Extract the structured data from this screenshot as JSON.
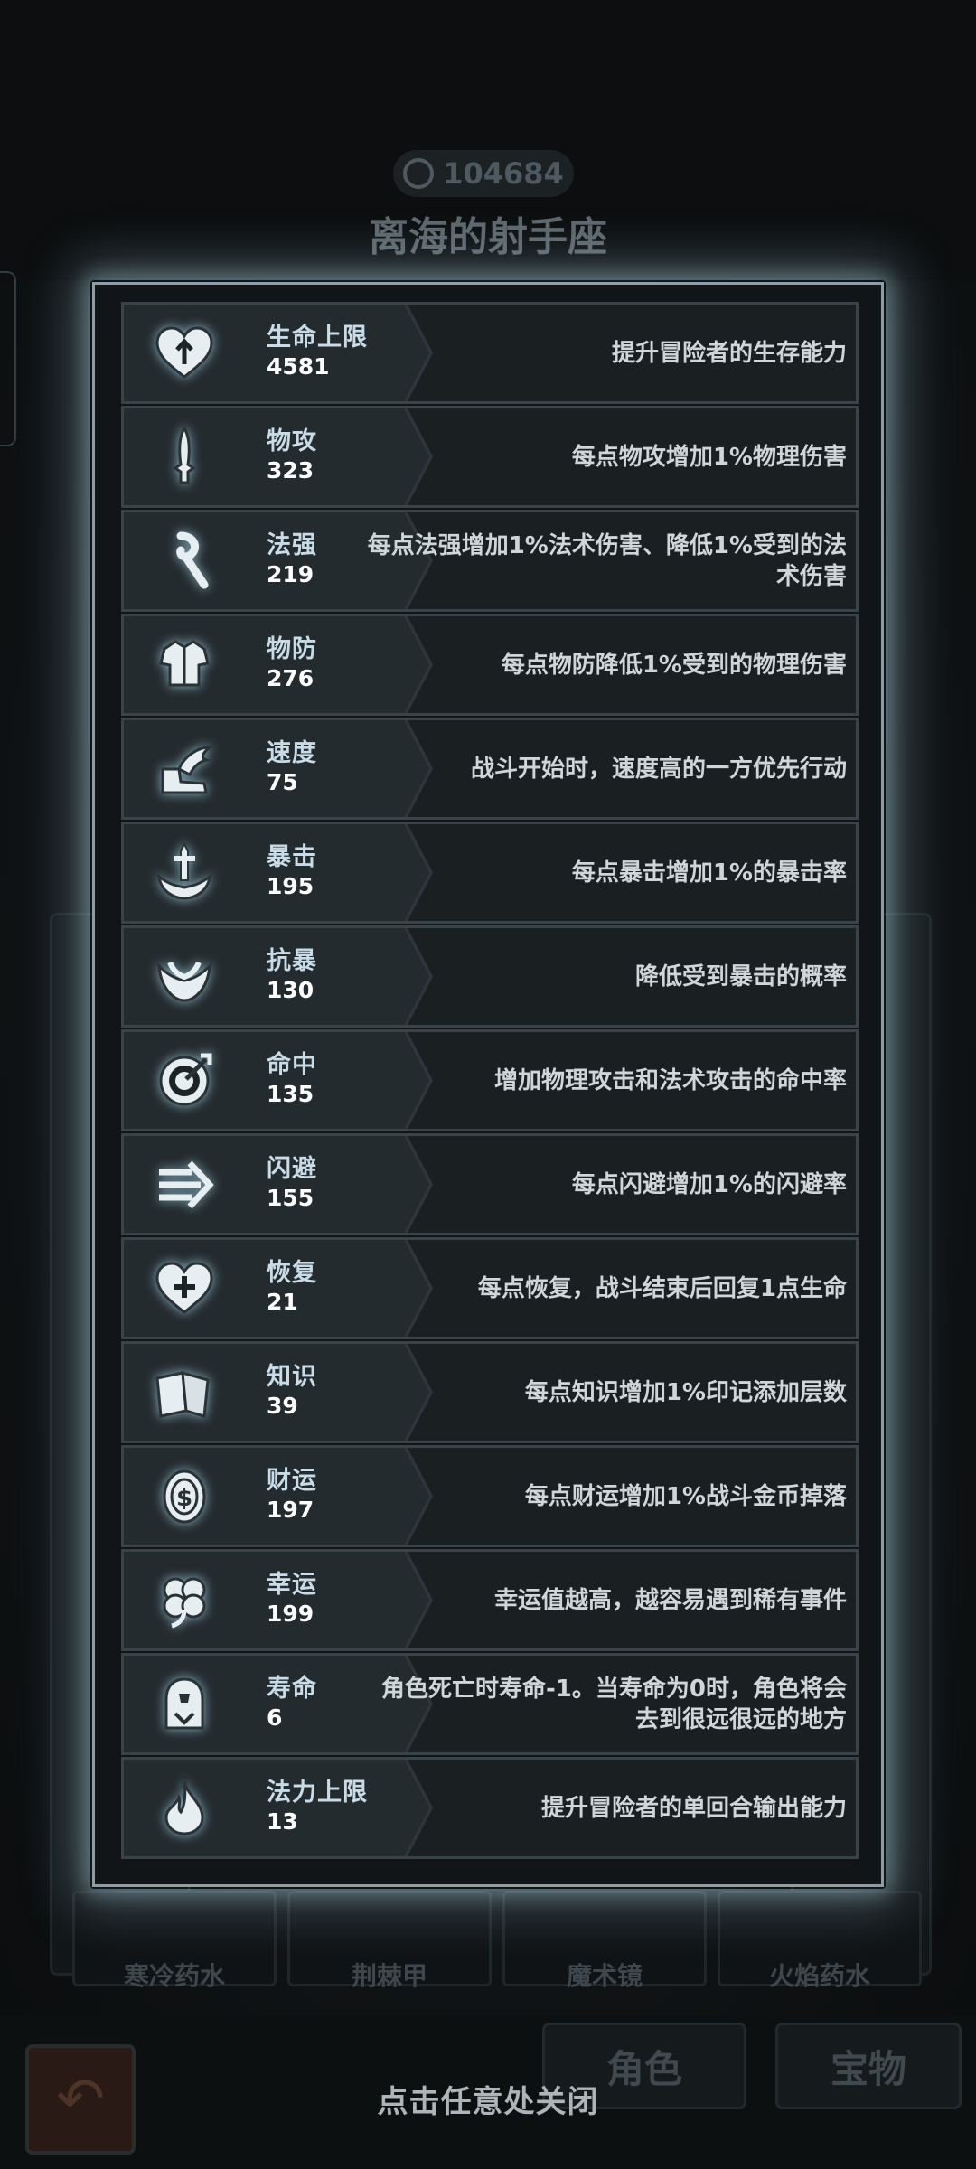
{
  "background": {
    "score": "104684",
    "title": "离海的射手座",
    "bottom_items": [
      "寒冷药水",
      "荆棘甲",
      "魔术镜",
      "火焰药水"
    ],
    "nav_tabs": [
      "角色",
      "宝物"
    ]
  },
  "stats": [
    {
      "icon": "heart-up-icon",
      "name": "生命上限",
      "value": "4581",
      "desc": "提升冒险者的生存能力"
    },
    {
      "icon": "sword-icon",
      "name": "物攻",
      "value": "323",
      "desc": "每点物攻增加1%物理伤害"
    },
    {
      "icon": "staff-icon",
      "name": "法强",
      "value": "219",
      "desc": "每点法强增加1%法术伤害、降低1%受到的法术伤害"
    },
    {
      "icon": "armor-icon",
      "name": "物防",
      "value": "276",
      "desc": "每点物防降低1%受到的物理伤害"
    },
    {
      "icon": "winged-boot-icon",
      "name": "速度",
      "value": "75",
      "desc": "战斗开始时，速度高的一方优先行动"
    },
    {
      "icon": "crit-sword-icon",
      "name": "暴击",
      "value": "195",
      "desc": "每点暴击增加1%的暴击率"
    },
    {
      "icon": "crit-resist-icon",
      "name": "抗暴",
      "value": "130",
      "desc": "降低受到暴击的概率"
    },
    {
      "icon": "target-icon",
      "name": "命中",
      "value": "135",
      "desc": "增加物理攻击和法术攻击的命中率"
    },
    {
      "icon": "dodge-arrow-icon",
      "name": "闪避",
      "value": "155",
      "desc": "每点闪避增加1%的闪避率"
    },
    {
      "icon": "heart-plus-icon",
      "name": "恢复",
      "value": "21",
      "desc": "每点恢复，战斗结束后回复1点生命"
    },
    {
      "icon": "book-icon",
      "name": "知识",
      "value": "39",
      "desc": "每点知识增加1%印记添加层数"
    },
    {
      "icon": "coin-icon",
      "name": "财运",
      "value": "197",
      "desc": "每点财运增加1%战斗金币掉落"
    },
    {
      "icon": "clover-icon",
      "name": "幸运",
      "value": "199",
      "desc": "幸运值越高，越容易遇到稀有事件"
    },
    {
      "icon": "tombstone-icon",
      "name": "寿命",
      "value": "6",
      "desc": "角色死亡时寿命-1。当寿命为0时，角色将会去到很远很远的地方"
    },
    {
      "icon": "mana-drop-icon",
      "name": "法力上限",
      "value": "13",
      "desc": "提升冒险者的单回合输出能力"
    }
  ],
  "close_hint": "点击任意处关闭"
}
